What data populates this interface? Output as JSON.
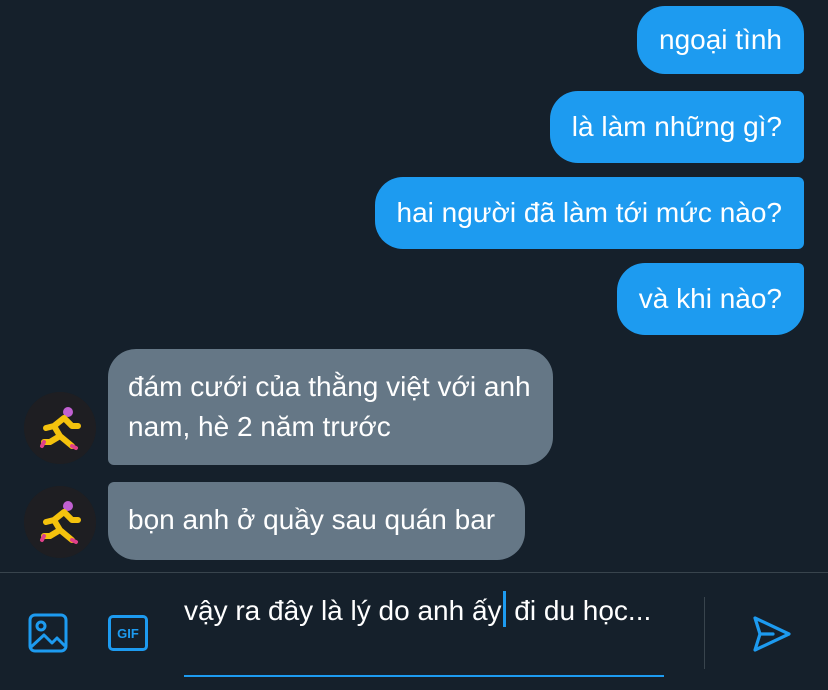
{
  "messages": {
    "sent": [
      "ngoại tình",
      "là làm những gì?",
      "hai người đã làm tới mức nào?",
      "và khi nào?"
    ],
    "received": [
      {
        "line1": "đám cưới của thằng việt với anh",
        "line2": "nam, hè 2 năm trước"
      },
      {
        "line1": "bọn anh ở quầy sau quán bar"
      }
    ]
  },
  "composer": {
    "text_before_caret": "vậy ra đây là lý do anh ấy",
    "text_after_caret": " đi du học...",
    "gif_label": "GIF"
  },
  "colors": {
    "background": "#15202b",
    "sent_bubble": "#1d9bf0",
    "received_bubble": "#657786",
    "accent": "#1d9bf0",
    "divider": "#38444d"
  },
  "icons": [
    "image-icon",
    "gif-icon",
    "send-icon",
    "avatar"
  ]
}
